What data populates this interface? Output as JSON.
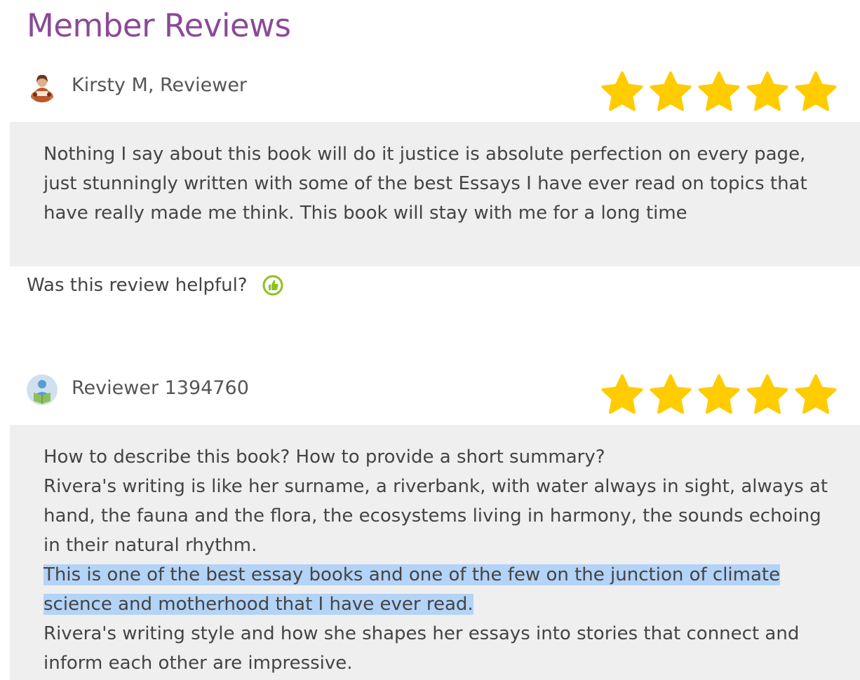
{
  "page": {
    "title": "Member Reviews",
    "title_color": "#8a4a96"
  },
  "reviews": [
    {
      "reviewer": "Kirsty M, Reviewer",
      "avatar_icon": "reader-portrait-avatar-icon",
      "rating": 5,
      "rating_max": 5,
      "paragraphs": [
        "Nothing I say about this book will do it justice is absolute perfection on every page, just stunningly written with some of the best Essays I have ever read on topics that have really made me think. This book will stay with me for a long time"
      ],
      "helpful_label": "Was this review helpful?",
      "helpful_icon": "thumbs-up-icon"
    },
    {
      "reviewer": "Reviewer 1394760",
      "avatar_icon": "generic-reader-avatar-icon",
      "rating": 5,
      "rating_max": 5,
      "paragraphs": [
        "How to describe this book? How to provide a short summary?",
        "Rivera's writing is like her surname, a riverbank, with water always in sight, always at hand, the fauna and the flora, the ecosystems living in harmony, the sounds echoing in their natural rhythm.",
        "This is one of the best essay books and one of the few on the junction of climate science and motherhood that I have ever read.",
        "Rivera's writing style and how she shapes her essays into stories that connect and inform each other are impressive."
      ],
      "highlighted_paragraph_index": 2
    }
  ],
  "colors": {
    "star": "#ffcc00",
    "panel_background": "#efefef",
    "selection_highlight": "#b3d3f7",
    "thumb_icon": "#8cc21f"
  }
}
